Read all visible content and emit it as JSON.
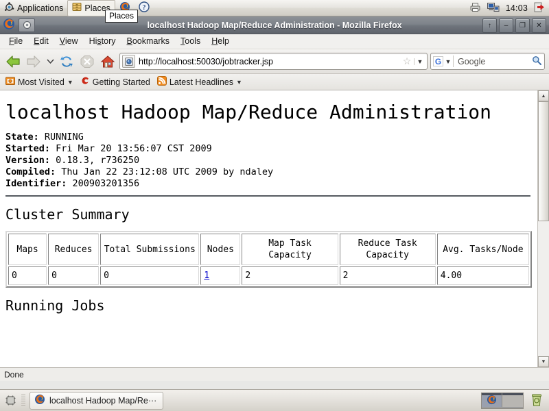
{
  "desktop": {
    "panel": {
      "applications_label": "Applications",
      "places_label": "Places",
      "tooltip_text": "Places",
      "clock": "14:03",
      "icons": [
        "applications-icon",
        "places-icon",
        "firefox-launcher-icon",
        "help-launcher-icon",
        "printer-tray-icon",
        "network-monitor-icon",
        "logout-icon"
      ]
    },
    "taskbar": {
      "window_button_label": "localhost Hadoop Map/Re···",
      "workspaces": 2,
      "active_workspace": 1
    }
  },
  "window": {
    "title": "localhost Hadoop Map/Reduce Administration - Mozilla Firefox",
    "buttons": {
      "shade": "↑",
      "minimize": "–",
      "maximize": "❐",
      "close": "✕"
    }
  },
  "menubar": {
    "items": [
      {
        "pre": "",
        "key": "F",
        "post": "ile"
      },
      {
        "pre": "",
        "key": "E",
        "post": "dit"
      },
      {
        "pre": "",
        "key": "V",
        "post": "iew"
      },
      {
        "pre": "Hi",
        "key": "s",
        "post": "tory"
      },
      {
        "pre": "",
        "key": "B",
        "post": "ookmarks"
      },
      {
        "pre": "",
        "key": "T",
        "post": "ools"
      },
      {
        "pre": "",
        "key": "H",
        "post": "elp"
      }
    ]
  },
  "navbar": {
    "back": "back-button",
    "forward": "forward-button",
    "reload": "reload-button",
    "stop": "stop-button",
    "home": "home-button",
    "url": "http://localhost:50030/jobtracker.jsp",
    "search_placeholder": "Google",
    "search_engine": "G"
  },
  "bookmarks": [
    {
      "label": "Most Visited",
      "icon": "most-visited-icon",
      "has_caret": true
    },
    {
      "label": "Getting Started",
      "icon": "firefox-bookmark-icon",
      "has_caret": false
    },
    {
      "label": "Latest Headlines",
      "icon": "rss-feed-icon",
      "has_caret": true
    }
  ],
  "page": {
    "title": "localhost Hadoop Map/Reduce Administration",
    "state_label": "State:",
    "state_value": "RUNNING",
    "started_label": "Started:",
    "started_value": "Fri Mar 20 13:56:07 CST 2009",
    "version_label": "Version:",
    "version_value": "0.18.3, r736250",
    "compiled_label": "Compiled:",
    "compiled_value": "Thu Jan 22 23:12:08 UTC 2009 by ndaley",
    "identifier_label": "Identifier:",
    "identifier_value": "200903201356",
    "cluster_summary_heading": "Cluster Summary",
    "running_jobs_heading": "Running Jobs",
    "cluster_table": {
      "headers": [
        "Maps",
        "Reduces",
        "Total Submissions",
        "Nodes",
        "Map Task Capacity",
        "Reduce Task Capacity",
        "Avg. Tasks/Node"
      ],
      "row": [
        "0",
        "0",
        "0",
        "1",
        "2",
        "2",
        "4.00"
      ],
      "link_cell_index": 3
    },
    "link_color": "#0000cc"
  },
  "statusbar": {
    "text": "Done"
  }
}
